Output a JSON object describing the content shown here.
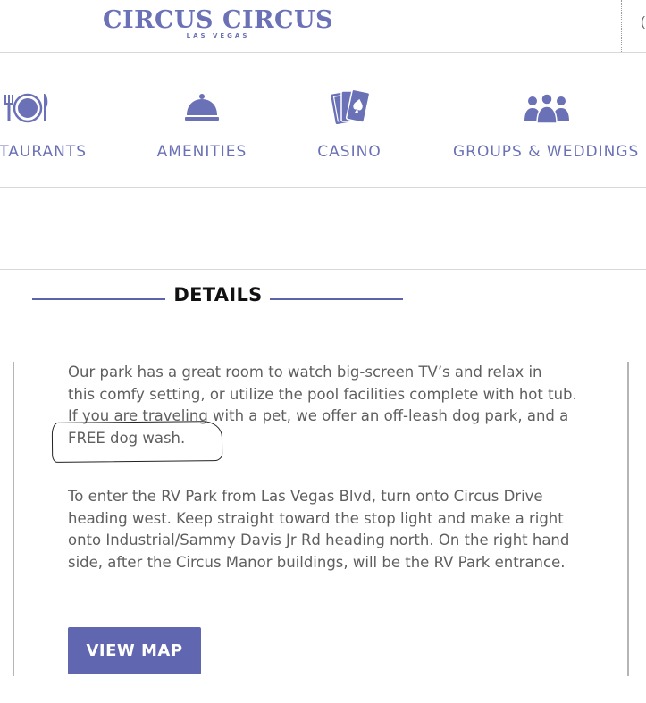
{
  "header": {
    "logo": {
      "main": "CIRCUS CIRCUS",
      "sub": "LAS VEGAS"
    },
    "cut_text": "("
  },
  "nav": {
    "items": [
      {
        "label": "TAURANTS",
        "icon": "restaurant-icon"
      },
      {
        "label": "AMENITIES",
        "icon": "cloche-icon"
      },
      {
        "label": "CASINO",
        "icon": "playing-cards-icon"
      },
      {
        "label": "GROUPS & WEDDINGS",
        "icon": "group-icon"
      }
    ]
  },
  "details": {
    "title": "DETAILS",
    "paragraph1": [
      "Our park has a great room to watch big-screen TV’s and relax in",
      "this comfy setting, or utilize the pool facilities complete with hot tub.",
      "If you are traveling with a pet, we offer an off-leash dog park, and a",
      "FREE dog wash."
    ],
    "paragraph2": [
      "To enter the RV Park from Las Vegas Blvd, turn onto Circus Drive",
      "heading west. Keep straight toward the stop light and make a right",
      "onto Industrial/Sammy Davis Jr Rd heading north. On the right hand",
      "side, after the Circus Manor buildings, will be the RV Park entrance."
    ],
    "button_label": "VIEW MAP"
  },
  "colors": {
    "brand": "#6b71b6",
    "button": "#6067b0",
    "rule": "#5d63ab",
    "body_text": "#5f5f5f"
  }
}
